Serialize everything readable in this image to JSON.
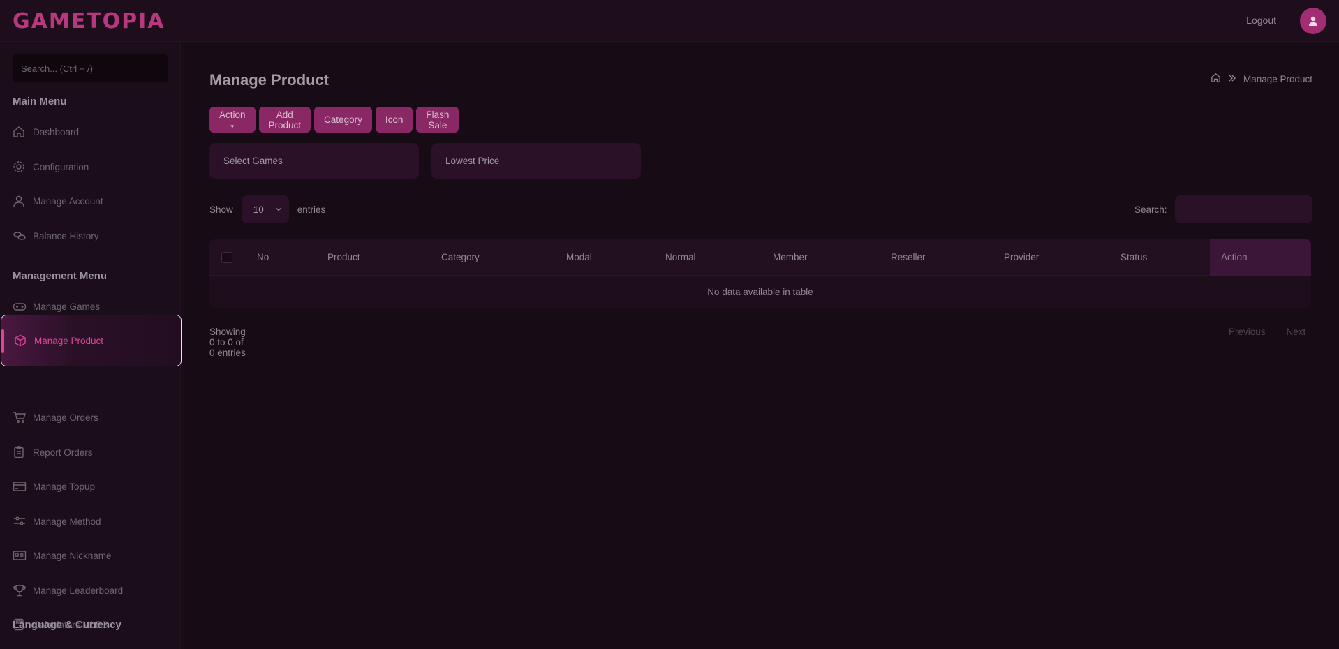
{
  "app": {
    "logo": "GAMETOPIA",
    "logout_label": "Logout"
  },
  "sidebar": {
    "search_placeholder": "Search... (Ctrl + /)",
    "main_menu_header": "Main Menu",
    "main_items": [
      {
        "label": "Dashboard",
        "icon": "home-icon"
      },
      {
        "label": "Configuration",
        "icon": "gear-icon"
      },
      {
        "label": "Manage Account",
        "icon": "user-icon"
      },
      {
        "label": "Balance History",
        "icon": "coins-icon"
      }
    ],
    "management_menu_header": "Management Menu",
    "management_items": [
      {
        "label": "Manage Games",
        "icon": "gamepad-icon"
      },
      {
        "label": "Manage Product",
        "icon": "box-icon",
        "active": true
      },
      {
        "label": "Manage Orders",
        "icon": "cart-icon"
      },
      {
        "label": "Report Orders",
        "icon": "clipboard-icon"
      },
      {
        "label": "Manage Topup",
        "icon": "card-icon"
      },
      {
        "label": "Manage Method",
        "icon": "sliders-icon"
      },
      {
        "label": "Manage Nickname",
        "icon": "id-card-icon"
      },
      {
        "label": "Manage Leaderboard",
        "icon": "trophy-icon"
      },
      {
        "label": "Calculators MLBB",
        "icon": "calculator-icon"
      }
    ],
    "language_header": "Language & Currency"
  },
  "page": {
    "title": "Manage Product",
    "breadcrumb_current": "Manage Product",
    "buttons": {
      "action": "Action",
      "add_product": "Add Product",
      "category": "Category",
      "icon": "Icon",
      "flash_sale": "Flash Sale"
    },
    "filters": {
      "games": "Select Games",
      "price": "Lowest Price"
    },
    "length": {
      "show": "Show",
      "value": "10",
      "entries": "entries"
    },
    "search_label": "Search:",
    "table": {
      "columns": [
        "No",
        "Product",
        "Category",
        "Modal",
        "Normal",
        "Member",
        "Reseller",
        "Provider",
        "Status",
        "Action"
      ],
      "empty_message": "No data available in table"
    },
    "info": "Showing 0 to 0 of 0 entries",
    "pager": {
      "previous": "Previous",
      "next": "Next"
    }
  },
  "colors": {
    "accent": "#e0449a",
    "button": "#8a2865",
    "background": "#170b16"
  }
}
